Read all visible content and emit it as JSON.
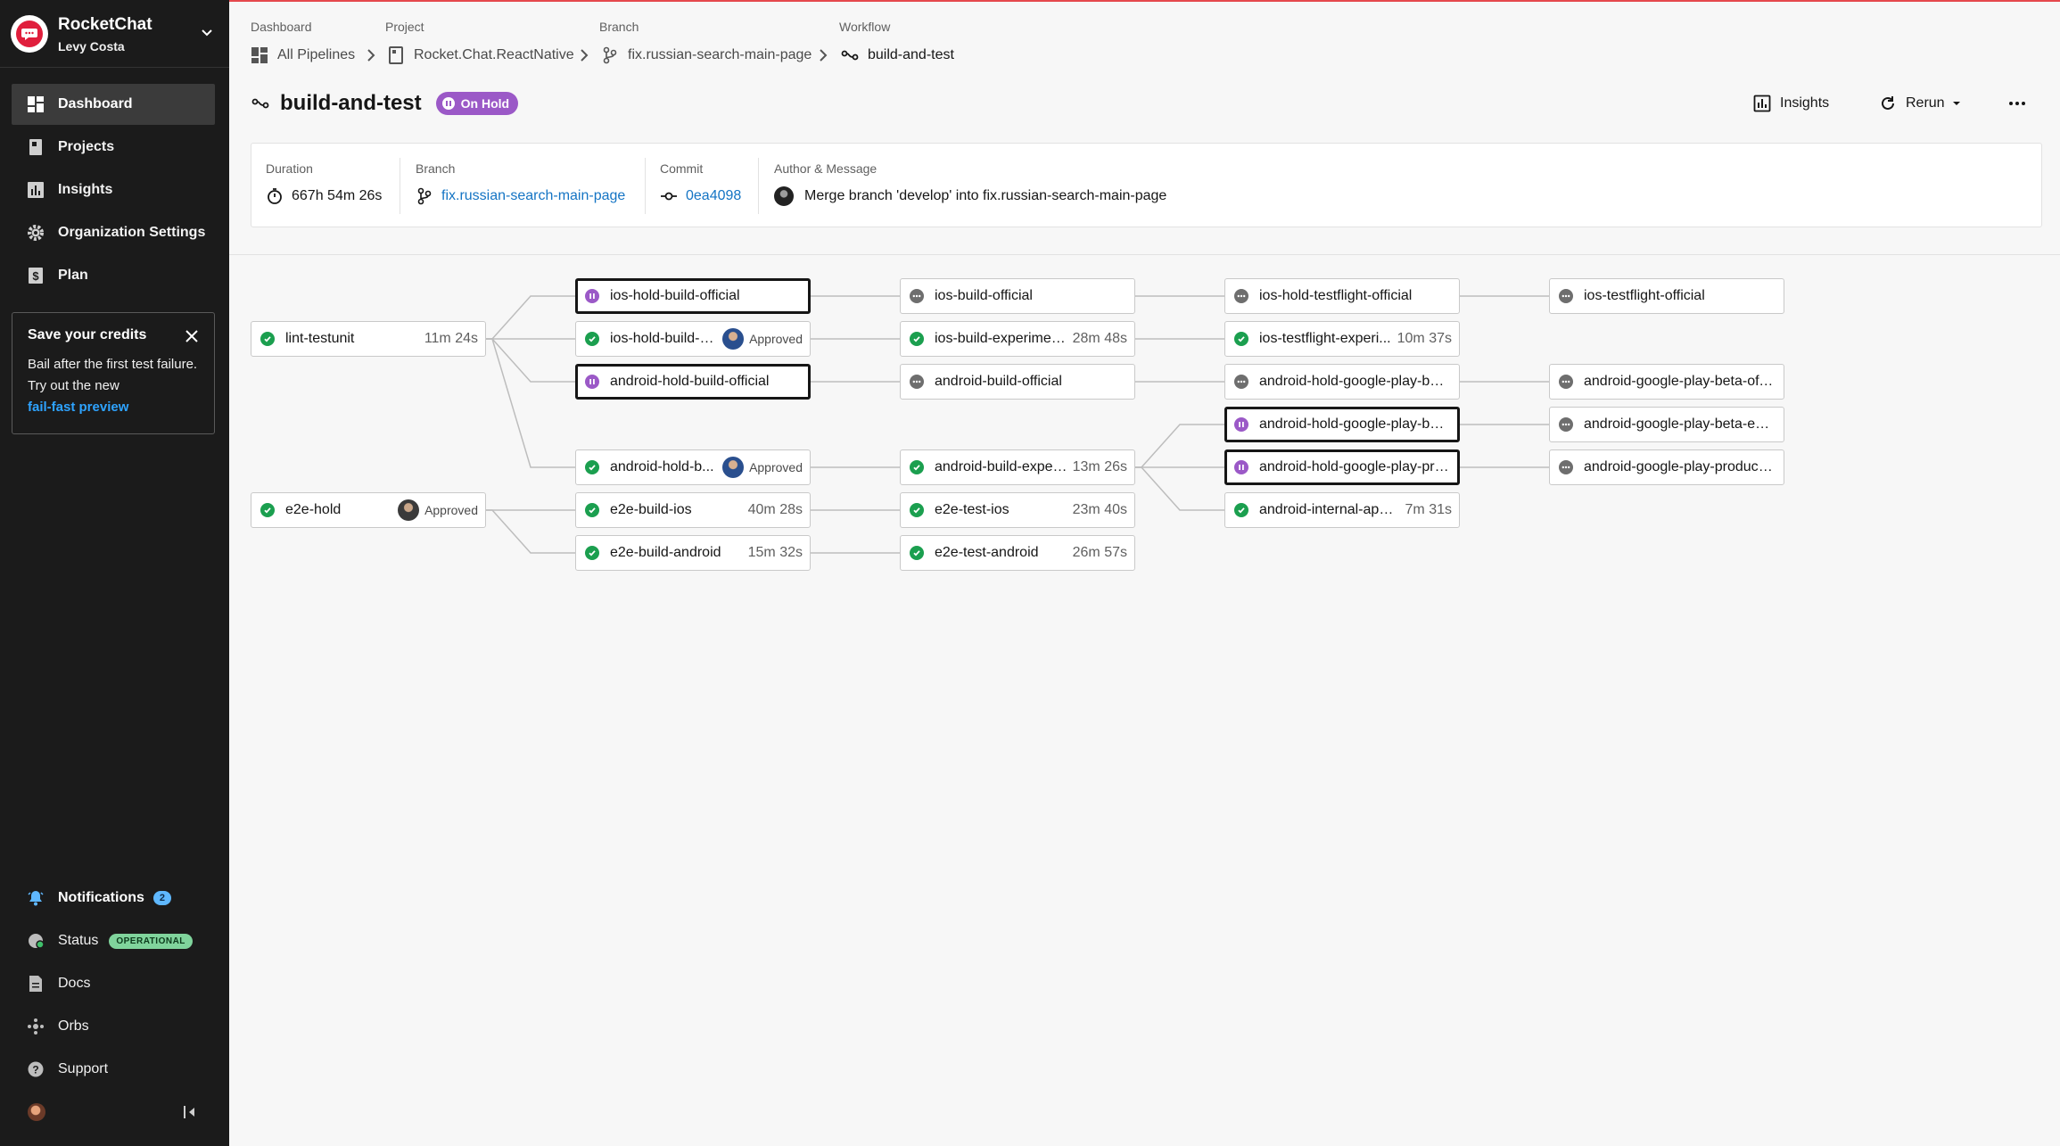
{
  "org": {
    "name": "RocketChat",
    "user": "Levy Costa"
  },
  "nav": [
    {
      "label": "Dashboard",
      "icon": "dashboard-icon",
      "active": true
    },
    {
      "label": "Projects",
      "icon": "projects-icon"
    },
    {
      "label": "Insights",
      "icon": "insights-icon"
    },
    {
      "label": "Organization Settings",
      "icon": "gear-icon"
    },
    {
      "label": "Plan",
      "icon": "dollar-icon"
    }
  ],
  "promo": {
    "title": "Save your credits",
    "body": "Bail after the first test failure. Try out the new",
    "link": "fail-fast preview"
  },
  "bottom_nav": {
    "notifications": {
      "label": "Notifications",
      "count": "2"
    },
    "status": {
      "label": "Status",
      "badge": "OPERATIONAL"
    },
    "docs": "Docs",
    "orbs": "Orbs",
    "support": "Support"
  },
  "breadcrumb": {
    "dashboard": {
      "label": "Dashboard",
      "value": "All Pipelines"
    },
    "project": {
      "label": "Project",
      "value": "Rocket.Chat.ReactNative"
    },
    "branch": {
      "label": "Branch",
      "value": "fix.russian-search-main-page"
    },
    "workflow": {
      "label": "Workflow",
      "value": "build-and-test"
    }
  },
  "workflow": {
    "title": "build-and-test",
    "status": "On Hold"
  },
  "actions": {
    "insights": "Insights",
    "rerun": "Rerun"
  },
  "summary": {
    "duration": {
      "label": "Duration",
      "value": "667h 54m 26s"
    },
    "branch": {
      "label": "Branch",
      "value": "fix.russian-search-main-page"
    },
    "commit": {
      "label": "Commit",
      "value": "0ea4098"
    },
    "author": {
      "label": "Author & Message",
      "value": "Merge branch 'develop' into fix.russian-search-main-page"
    }
  },
  "colors": {
    "success": "#1b9f4f",
    "on_hold": "#9b59c7",
    "blocked": "#6e6e6e",
    "link": "#1474c4",
    "sidebar": "#1b1b1b"
  },
  "jobs": [
    {
      "id": "lint",
      "name": "lint-testunit",
      "status": "success",
      "duration": "11m 24s"
    },
    {
      "id": "e2ehold",
      "name": "e2e-hold",
      "status": "success",
      "approved": "Approved",
      "avatar": true
    },
    {
      "id": "ioshold",
      "name": "ios-hold-build-official",
      "status": "on-hold"
    },
    {
      "id": "iosholdexp",
      "name": "ios-hold-build-e...",
      "status": "success",
      "approved": "Approved",
      "avatar": true
    },
    {
      "id": "andhold",
      "name": "android-hold-build-official",
      "status": "on-hold"
    },
    {
      "id": "andholdexp",
      "name": "android-hold-b...",
      "status": "success",
      "approved": "Approved",
      "avatar": true
    },
    {
      "id": "e2eios",
      "name": "e2e-build-ios",
      "status": "success",
      "duration": "40m 28s"
    },
    {
      "id": "e2eand",
      "name": "e2e-build-android",
      "status": "success",
      "duration": "15m 32s"
    },
    {
      "id": "iosbuild",
      "name": "ios-build-official",
      "status": "blocked"
    },
    {
      "id": "iosbuildexp",
      "name": "ios-build-experimental",
      "status": "success",
      "duration": "28m 48s"
    },
    {
      "id": "andbuild",
      "name": "android-build-official",
      "status": "blocked"
    },
    {
      "id": "andbuildexp",
      "name": "android-build-experi...",
      "status": "success",
      "duration": "13m 26s"
    },
    {
      "id": "e2etestios",
      "name": "e2e-test-ios",
      "status": "success",
      "duration": "23m 40s"
    },
    {
      "id": "e2etestand",
      "name": "e2e-test-android",
      "status": "success",
      "duration": "26m 57s"
    },
    {
      "id": "iostfhold",
      "name": "ios-hold-testflight-official",
      "status": "blocked"
    },
    {
      "id": "iostfexp",
      "name": "ios-testflight-experi...",
      "status": "success",
      "duration": "10m 37s"
    },
    {
      "id": "gpbetaoff",
      "name": "android-hold-google-play-bet...",
      "status": "blocked"
    },
    {
      "id": "gpbetaexp",
      "name": "android-hold-google-play-bet...",
      "status": "on-hold"
    },
    {
      "id": "gpprod",
      "name": "android-hold-google-play-pro...",
      "status": "on-hold"
    },
    {
      "id": "internal",
      "name": "android-internal-app-s...",
      "status": "success",
      "duration": "7m 31s"
    },
    {
      "id": "iostf",
      "name": "ios-testflight-official",
      "status": "blocked"
    },
    {
      "id": "gpboff",
      "name": "android-google-play-beta-offi...",
      "status": "blocked"
    },
    {
      "id": "gpbexp",
      "name": "android-google-play-beta-exp...",
      "status": "blocked"
    },
    {
      "id": "gpprodrel",
      "name": "android-google-play-producti...",
      "status": "blocked"
    }
  ]
}
